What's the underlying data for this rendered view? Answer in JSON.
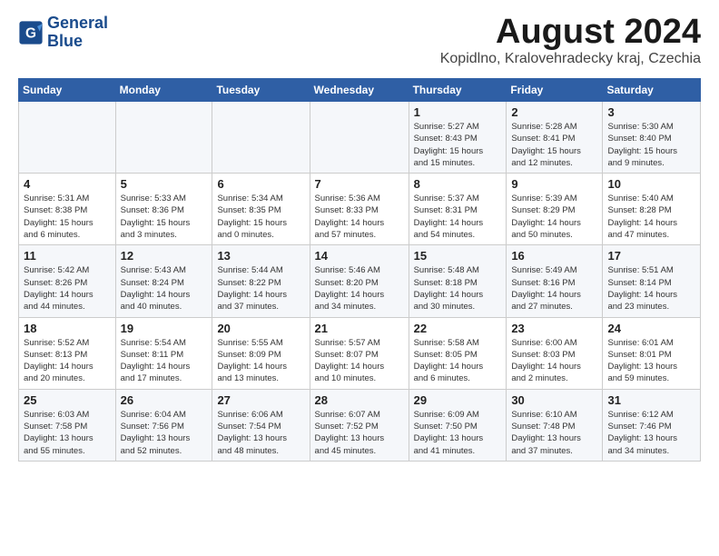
{
  "header": {
    "logo_line1": "General",
    "logo_line2": "Blue",
    "title": "August 2024",
    "subtitle": "Kopidlno, Kralovehradecky kraj, Czechia"
  },
  "weekdays": [
    "Sunday",
    "Monday",
    "Tuesday",
    "Wednesday",
    "Thursday",
    "Friday",
    "Saturday"
  ],
  "weeks": [
    [
      {
        "day": "",
        "detail": ""
      },
      {
        "day": "",
        "detail": ""
      },
      {
        "day": "",
        "detail": ""
      },
      {
        "day": "",
        "detail": ""
      },
      {
        "day": "1",
        "detail": "Sunrise: 5:27 AM\nSunset: 8:43 PM\nDaylight: 15 hours\nand 15 minutes."
      },
      {
        "day": "2",
        "detail": "Sunrise: 5:28 AM\nSunset: 8:41 PM\nDaylight: 15 hours\nand 12 minutes."
      },
      {
        "day": "3",
        "detail": "Sunrise: 5:30 AM\nSunset: 8:40 PM\nDaylight: 15 hours\nand 9 minutes."
      }
    ],
    [
      {
        "day": "4",
        "detail": "Sunrise: 5:31 AM\nSunset: 8:38 PM\nDaylight: 15 hours\nand 6 minutes."
      },
      {
        "day": "5",
        "detail": "Sunrise: 5:33 AM\nSunset: 8:36 PM\nDaylight: 15 hours\nand 3 minutes."
      },
      {
        "day": "6",
        "detail": "Sunrise: 5:34 AM\nSunset: 8:35 PM\nDaylight: 15 hours\nand 0 minutes."
      },
      {
        "day": "7",
        "detail": "Sunrise: 5:36 AM\nSunset: 8:33 PM\nDaylight: 14 hours\nand 57 minutes."
      },
      {
        "day": "8",
        "detail": "Sunrise: 5:37 AM\nSunset: 8:31 PM\nDaylight: 14 hours\nand 54 minutes."
      },
      {
        "day": "9",
        "detail": "Sunrise: 5:39 AM\nSunset: 8:29 PM\nDaylight: 14 hours\nand 50 minutes."
      },
      {
        "day": "10",
        "detail": "Sunrise: 5:40 AM\nSunset: 8:28 PM\nDaylight: 14 hours\nand 47 minutes."
      }
    ],
    [
      {
        "day": "11",
        "detail": "Sunrise: 5:42 AM\nSunset: 8:26 PM\nDaylight: 14 hours\nand 44 minutes."
      },
      {
        "day": "12",
        "detail": "Sunrise: 5:43 AM\nSunset: 8:24 PM\nDaylight: 14 hours\nand 40 minutes."
      },
      {
        "day": "13",
        "detail": "Sunrise: 5:44 AM\nSunset: 8:22 PM\nDaylight: 14 hours\nand 37 minutes."
      },
      {
        "day": "14",
        "detail": "Sunrise: 5:46 AM\nSunset: 8:20 PM\nDaylight: 14 hours\nand 34 minutes."
      },
      {
        "day": "15",
        "detail": "Sunrise: 5:48 AM\nSunset: 8:18 PM\nDaylight: 14 hours\nand 30 minutes."
      },
      {
        "day": "16",
        "detail": "Sunrise: 5:49 AM\nSunset: 8:16 PM\nDaylight: 14 hours\nand 27 minutes."
      },
      {
        "day": "17",
        "detail": "Sunrise: 5:51 AM\nSunset: 8:14 PM\nDaylight: 14 hours\nand 23 minutes."
      }
    ],
    [
      {
        "day": "18",
        "detail": "Sunrise: 5:52 AM\nSunset: 8:13 PM\nDaylight: 14 hours\nand 20 minutes."
      },
      {
        "day": "19",
        "detail": "Sunrise: 5:54 AM\nSunset: 8:11 PM\nDaylight: 14 hours\nand 17 minutes."
      },
      {
        "day": "20",
        "detail": "Sunrise: 5:55 AM\nSunset: 8:09 PM\nDaylight: 14 hours\nand 13 minutes."
      },
      {
        "day": "21",
        "detail": "Sunrise: 5:57 AM\nSunset: 8:07 PM\nDaylight: 14 hours\nand 10 minutes."
      },
      {
        "day": "22",
        "detail": "Sunrise: 5:58 AM\nSunset: 8:05 PM\nDaylight: 14 hours\nand 6 minutes."
      },
      {
        "day": "23",
        "detail": "Sunrise: 6:00 AM\nSunset: 8:03 PM\nDaylight: 14 hours\nand 2 minutes."
      },
      {
        "day": "24",
        "detail": "Sunrise: 6:01 AM\nSunset: 8:01 PM\nDaylight: 13 hours\nand 59 minutes."
      }
    ],
    [
      {
        "day": "25",
        "detail": "Sunrise: 6:03 AM\nSunset: 7:58 PM\nDaylight: 13 hours\nand 55 minutes."
      },
      {
        "day": "26",
        "detail": "Sunrise: 6:04 AM\nSunset: 7:56 PM\nDaylight: 13 hours\nand 52 minutes."
      },
      {
        "day": "27",
        "detail": "Sunrise: 6:06 AM\nSunset: 7:54 PM\nDaylight: 13 hours\nand 48 minutes."
      },
      {
        "day": "28",
        "detail": "Sunrise: 6:07 AM\nSunset: 7:52 PM\nDaylight: 13 hours\nand 45 minutes."
      },
      {
        "day": "29",
        "detail": "Sunrise: 6:09 AM\nSunset: 7:50 PM\nDaylight: 13 hours\nand 41 minutes."
      },
      {
        "day": "30",
        "detail": "Sunrise: 6:10 AM\nSunset: 7:48 PM\nDaylight: 13 hours\nand 37 minutes."
      },
      {
        "day": "31",
        "detail": "Sunrise: 6:12 AM\nSunset: 7:46 PM\nDaylight: 13 hours\nand 34 minutes."
      }
    ]
  ]
}
